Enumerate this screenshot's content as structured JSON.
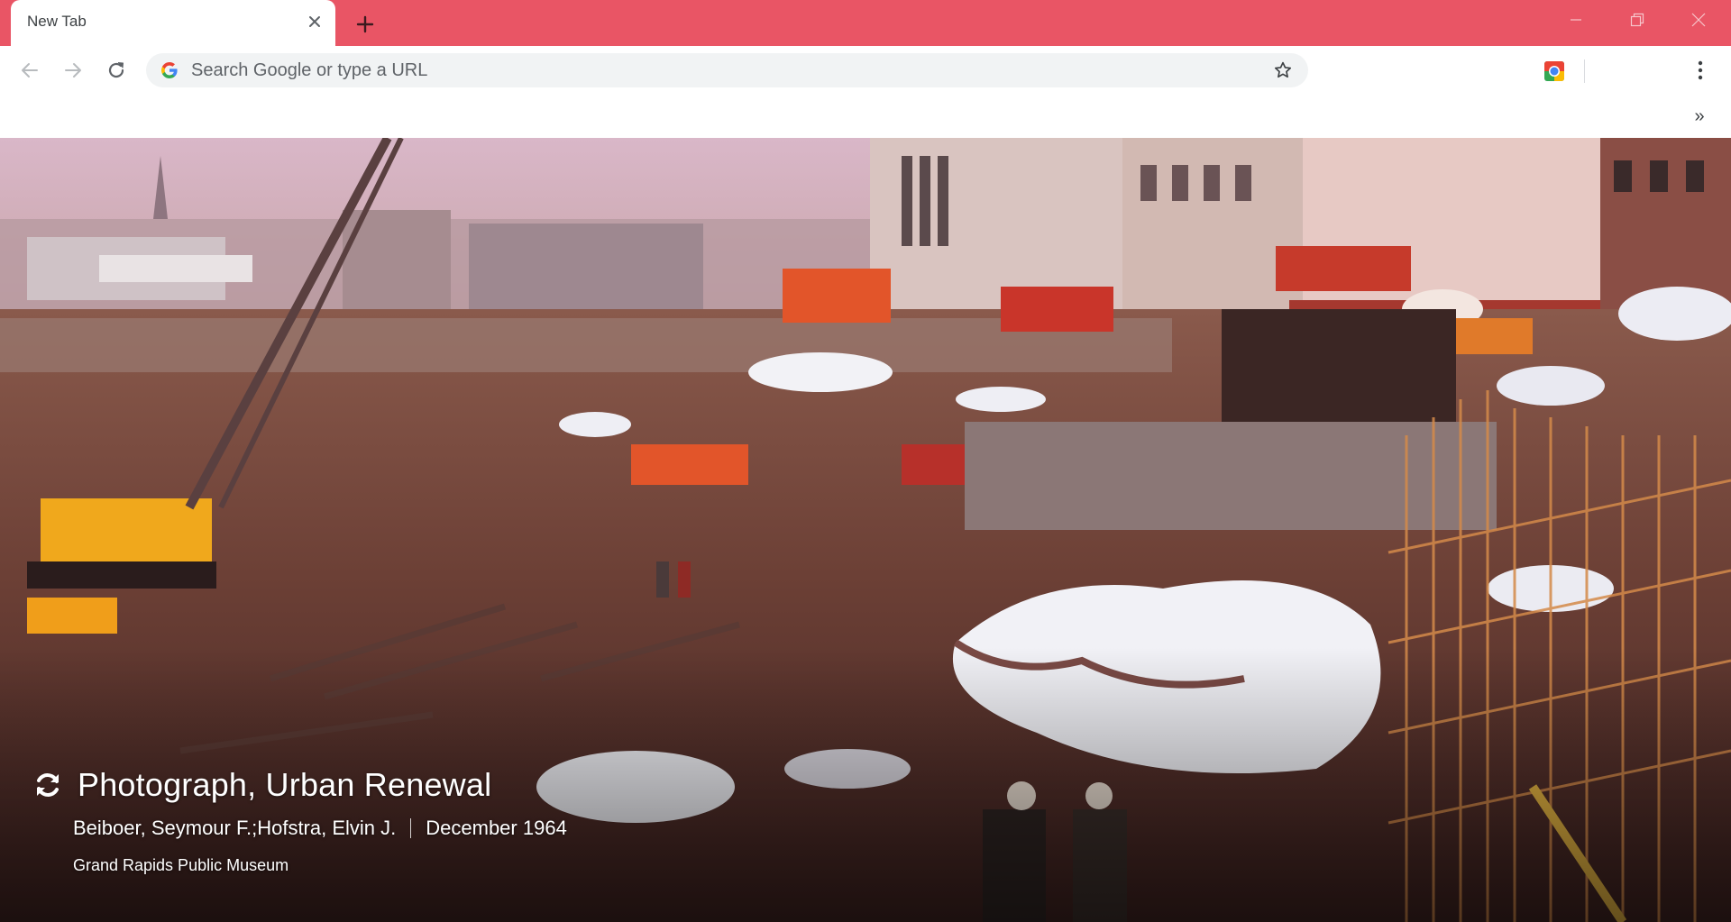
{
  "tab": {
    "title": "New Tab"
  },
  "omnibox": {
    "placeholder": "Search Google or type a URL",
    "value": ""
  },
  "bookmarks": {
    "overflow_label": "»"
  },
  "attribution": {
    "title": "Photograph, Urban Renewal",
    "author": "Beiboer, Seymour F.;Hofstra, Elvin J.",
    "date": "December 1964",
    "source": "Grand Rapids Public Museum"
  },
  "colors": {
    "frame": "#e95565",
    "toolbar": "#ffffff",
    "omnibox": "#f1f3f4"
  },
  "icons": {
    "tab_close": "close-icon",
    "new_tab": "plus-icon",
    "back": "arrow-left-icon",
    "forward": "arrow-right-icon",
    "reload": "reload-icon",
    "search_engine": "google-g-icon",
    "bookmark": "star-icon",
    "extension": "extension-icon",
    "menu": "kebab-menu-icon",
    "refresh_background": "refresh-icon"
  }
}
